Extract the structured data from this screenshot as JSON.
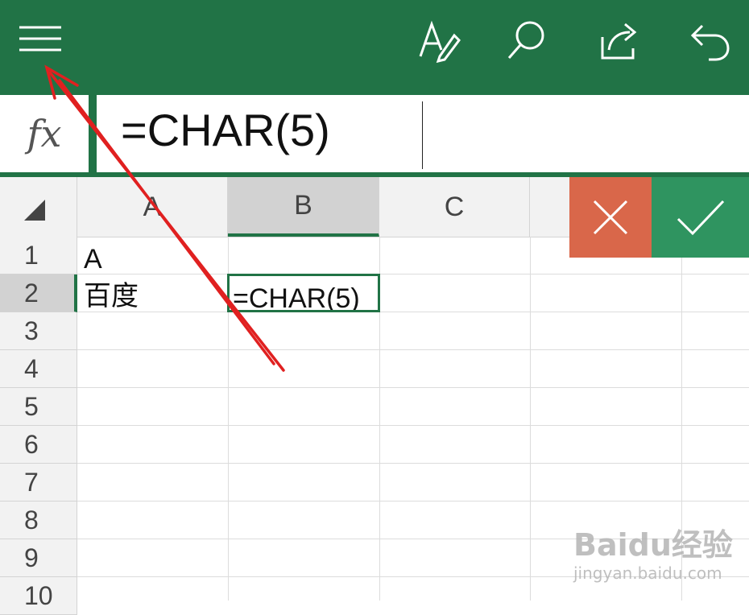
{
  "toolbar": {
    "icons": [
      "menu-icon",
      "format-text-icon",
      "search-icon",
      "share-icon",
      "undo-icon"
    ],
    "bg": "#217346"
  },
  "formula_bar": {
    "fx_label": "fx",
    "value": "=CHAR(5)"
  },
  "sheet": {
    "columns": [
      "A",
      "B",
      "C"
    ],
    "selected_column": "B",
    "rows": [
      "1",
      "2",
      "3",
      "4",
      "5",
      "6",
      "7",
      "8",
      "9",
      "10"
    ],
    "selected_row": "2",
    "cells": {
      "A1": "A",
      "A2": "百度",
      "B2": "=CHAR(5)"
    }
  },
  "edit_buttons": {
    "cancel_color": "#d9674a",
    "confirm_color": "#2f9460"
  },
  "watermark": {
    "logo": "Baidu经验",
    "url": "jingyan.baidu.com"
  }
}
